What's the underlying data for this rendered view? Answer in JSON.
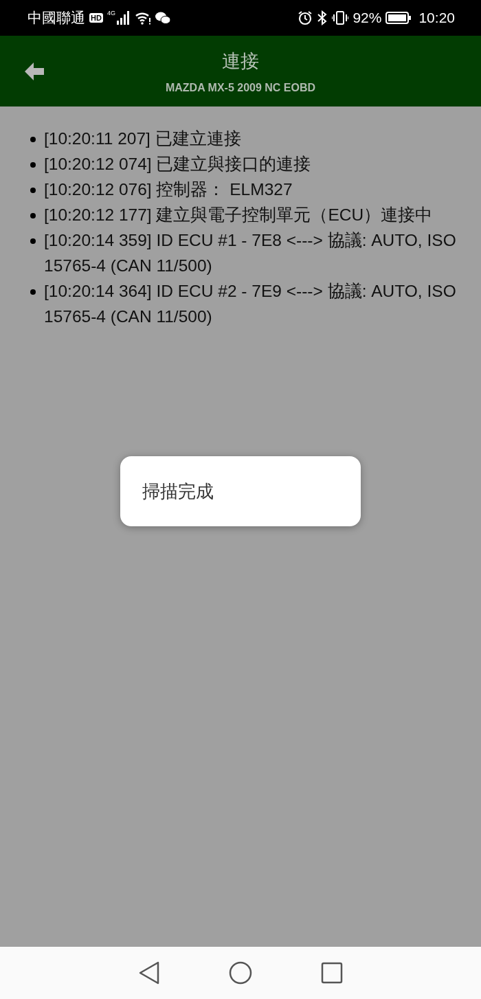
{
  "status_bar": {
    "carrier": "中國聯通",
    "hd_badge": "HD",
    "network": "4G",
    "battery": "92%",
    "time": "10:20"
  },
  "header": {
    "title": "連接",
    "subtitle": "MAZDA MX-5 2009 NC EOBD"
  },
  "log": [
    "[10:20:11 207] 已建立連接",
    "[10:20:12 074] 已建立與接口的連接",
    "[10:20:12 076] 控制器： ELM327",
    "[10:20:12 177] 建立與電子控制單元（ECU）連接中",
    "[10:20:14 359] ID ECU #1 - 7E8 <---> 協議: AUTO, ISO 15765-4 (CAN 11/500)",
    "[10:20:14 364] ID ECU #2 - 7E9 <---> 協議: AUTO, ISO 15765-4 (CAN 11/500)"
  ],
  "toast": {
    "message": "掃描完成"
  }
}
